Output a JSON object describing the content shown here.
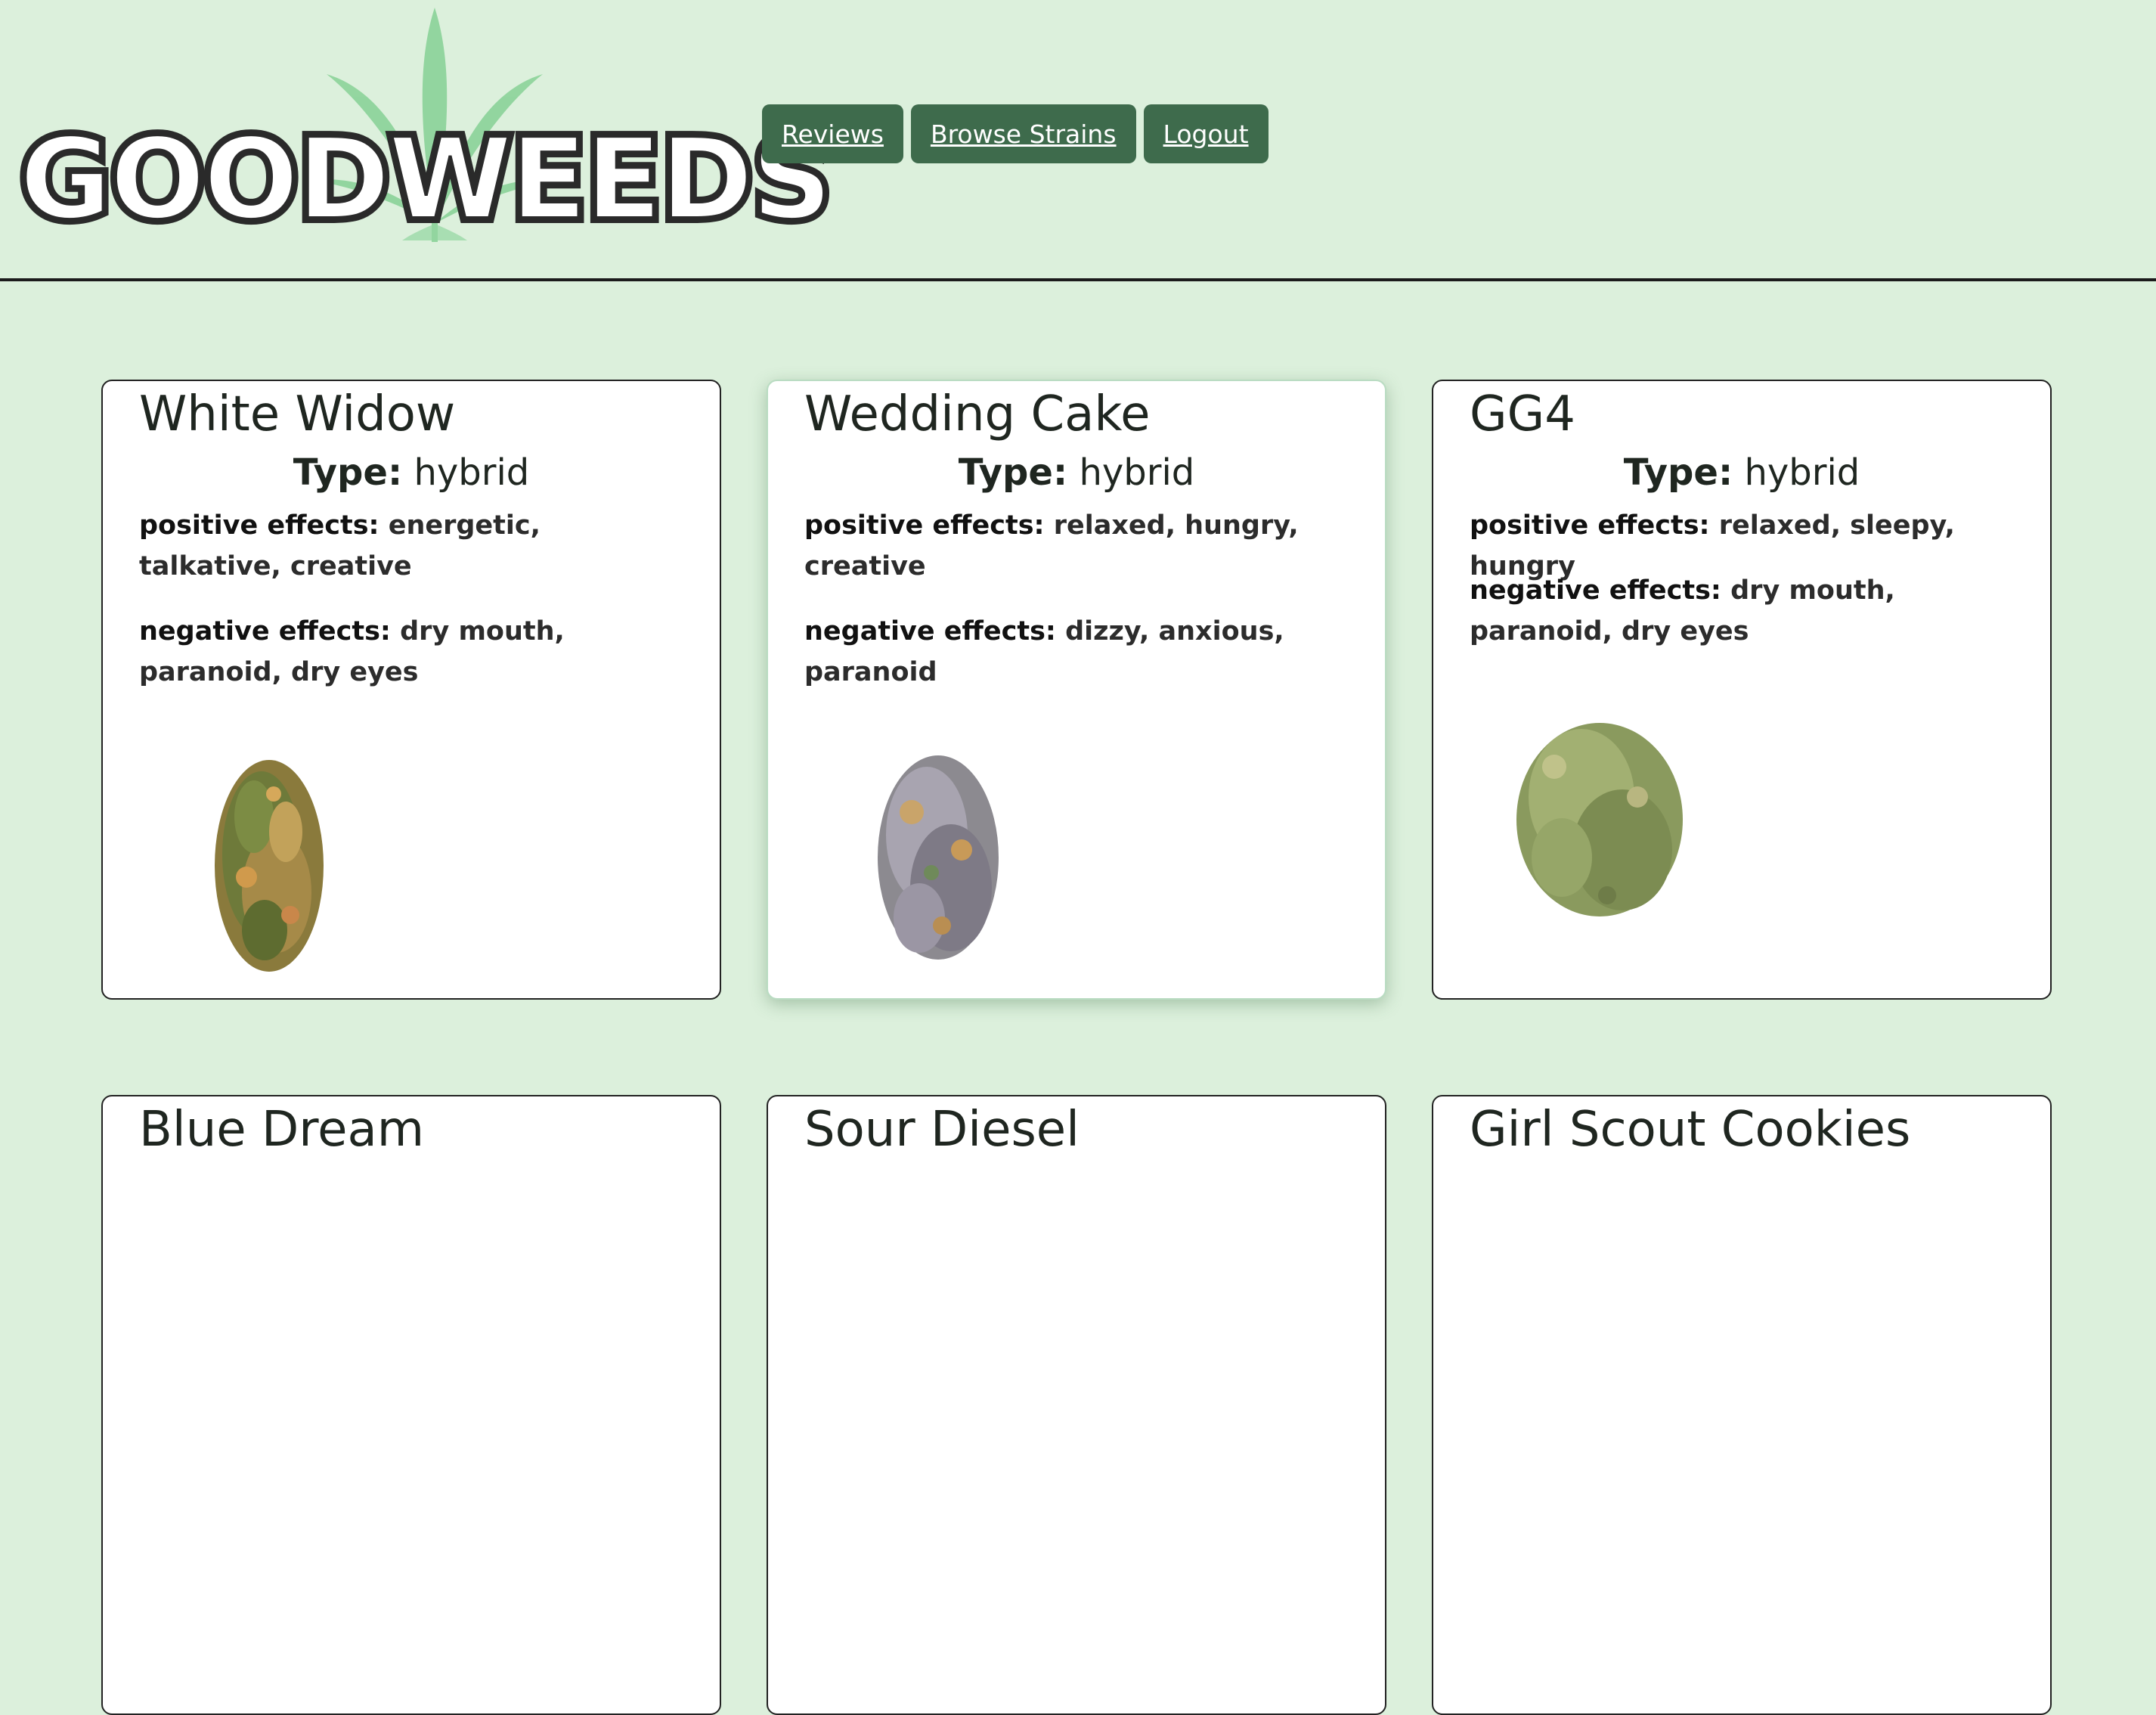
{
  "brand": {
    "logo_text": "GOODWEEDS",
    "logo_prefix": "GOOD",
    "logo_suffix": "WEEDS"
  },
  "nav": [
    {
      "label": "Reviews"
    },
    {
      "label": "Browse Strains"
    },
    {
      "label": "Logout"
    }
  ],
  "labels": {
    "type": "Type:",
    "positive": "positive effects:",
    "negative": "negative effects:"
  },
  "strains": [
    {
      "name": "White Widow",
      "type": "hybrid",
      "positive": "energetic, talkative, creative",
      "negative": "dry mouth, paranoid, dry eyes",
      "image": "cannabis-bud-image"
    },
    {
      "name": "Wedding Cake",
      "type": "hybrid",
      "positive": "relaxed, hungry, creative",
      "negative": "dizzy, anxious, paranoid",
      "image": "cannabis-bud-image"
    },
    {
      "name": "GG4",
      "type": "hybrid",
      "positive": "relaxed, sleepy, hungry",
      "negative": "dry mouth, paranoid, dry eyes",
      "image": "cannabis-bud-image"
    },
    {
      "name": "Blue Dream"
    },
    {
      "name": "Sour Diesel"
    },
    {
      "name": "Girl Scout Cookies"
    }
  ],
  "colors": {
    "page_bg": "#dcf0dc",
    "nav_bg": "#3e6b4c",
    "leaf": "#8fd49c",
    "logo_dark": "#2a2a2a"
  }
}
